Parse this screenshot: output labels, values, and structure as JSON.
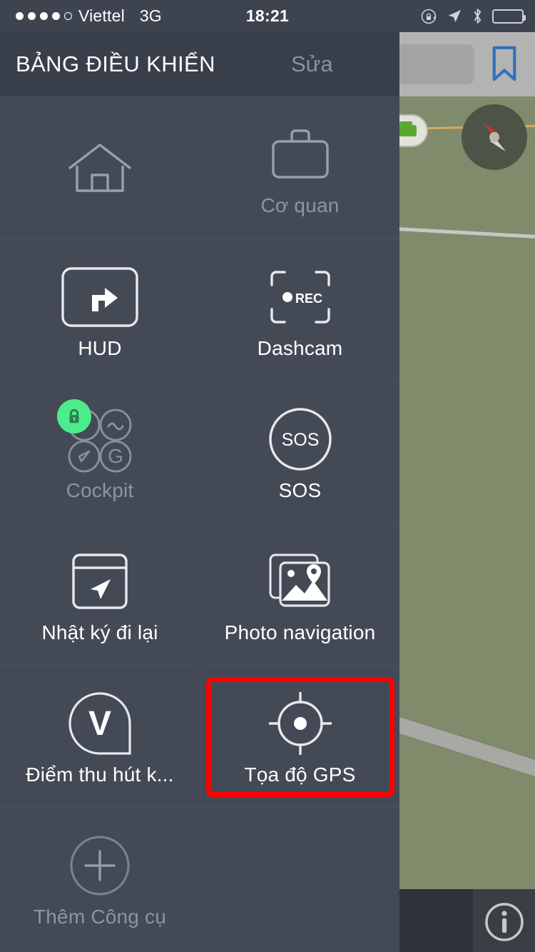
{
  "status_bar": {
    "signal_dots_filled": 4,
    "signal_dots_total": 5,
    "carrier": "Viettel",
    "network": "3G",
    "time": "18:21",
    "icons": [
      "rotation-lock-icon",
      "location-arrow-icon",
      "bluetooth-icon",
      "battery-icon"
    ],
    "battery_level_percent": 14,
    "battery_color": "#ff2222"
  },
  "panel": {
    "title": "BẢNG ĐIỀU KHIỂN",
    "edit_label": "Sửa",
    "background": "#434a56",
    "header_background": "#383e4a"
  },
  "grid": {
    "rows": [
      [
        {
          "label": "",
          "icon": "home-icon",
          "dimmed": true,
          "highlighted": false
        },
        {
          "label": "Cơ quan",
          "icon": "briefcase-icon",
          "dimmed": true,
          "highlighted": false
        }
      ],
      [
        {
          "label": "HUD",
          "icon": "hud-turn-right-icon",
          "dimmed": false,
          "highlighted": false
        },
        {
          "label": "Dashcam",
          "icon": "dashcam-rec-icon",
          "dimmed": false,
          "highlighted": false,
          "badge_text": "REC"
        }
      ],
      [
        {
          "label": "Cockpit",
          "icon": "cockpit-gauges-icon",
          "dimmed": true,
          "highlighted": false,
          "locked": true,
          "lock_color": "#4ceb8b"
        },
        {
          "label": "SOS",
          "icon": "sos-circle-icon",
          "dimmed": false,
          "highlighted": false,
          "badge_text": "SOS"
        }
      ],
      [
        {
          "label": "Nhật ký đi lại",
          "icon": "travel-log-icon",
          "dimmed": false,
          "highlighted": false
        },
        {
          "label": "Photo navigation",
          "icon": "photo-navigation-icon",
          "dimmed": false,
          "highlighted": false
        }
      ],
      [
        {
          "label": "Điểm thu hút k...",
          "icon": "poi-v-pin-icon",
          "dimmed": false,
          "highlighted": false,
          "badge_text": "V"
        },
        {
          "label": "Tọa độ GPS",
          "icon": "gps-crosshair-icon",
          "dimmed": false,
          "highlighted": true,
          "highlight_color": "#ff0000"
        }
      ],
      [
        {
          "label": "Thêm Công cụ",
          "icon": "add-plus-circle-icon",
          "dimmed": true,
          "highlighted": false
        },
        {
          "label": "",
          "icon": "",
          "dimmed": true,
          "highlighted": false
        }
      ]
    ]
  },
  "map": {
    "background_color": "#808b6b",
    "topbar_color": "#b3b3b3",
    "search_placeholder": "",
    "bookmark_icon": "bookmark-icon",
    "compass_icon": "compass-icon",
    "info_icon": "info-icon",
    "poi_icon": "park-marker-icon"
  }
}
